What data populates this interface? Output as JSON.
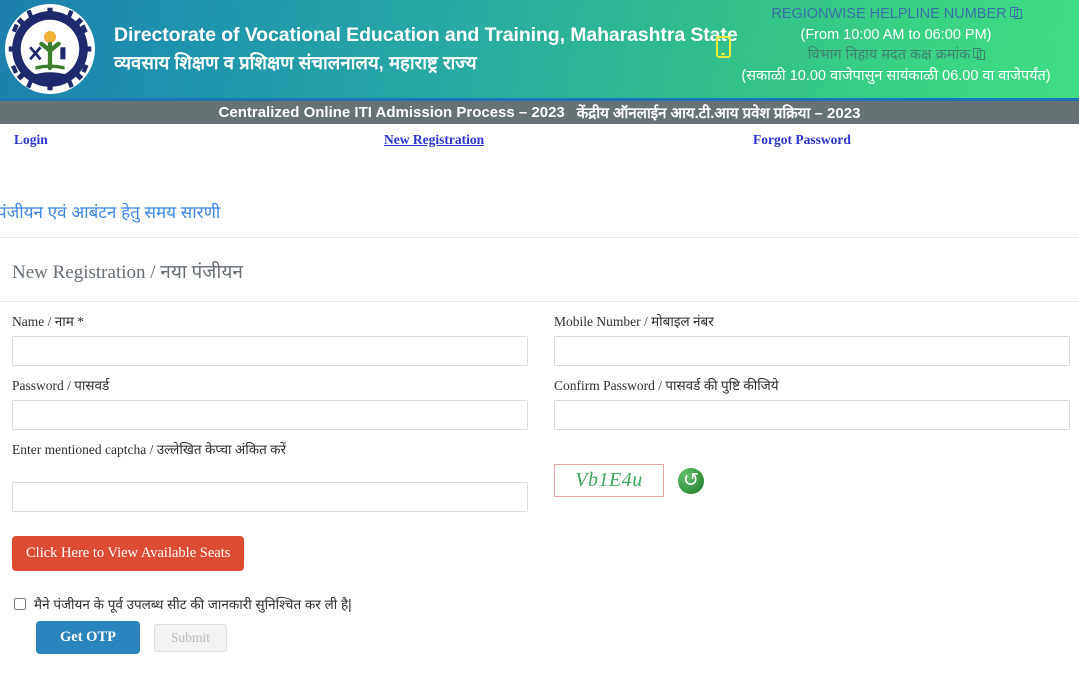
{
  "header": {
    "logo_alt": "dvet-logo",
    "title_en": "Directorate of Vocational Education and Training, Maharashtra State",
    "title_mr": "व्यवसाय शिक्षण व प्रशिक्षण संचालनालय, महाराष्ट्र राज्य",
    "phone_icon": "mobile-phone-icon",
    "helpline": {
      "line1": "REGIONWISE HELPLINE NUMBER",
      "line2": "(From 10:00 AM to 06:00 PM)",
      "line3": "विभाग निहाय मदत कक्ष क्रमांक",
      "line4": "(सकाळी 10.00 वाजेपासुन सायंकाळी 06.00 वा वाजेपर्यंत)",
      "copy_icon": "copy-icon"
    }
  },
  "titlebar": {
    "text_en": "Centralized Online ITI Admission Process – 2023",
    "text_mr": "केंद्रीय ऑनलाईन आय.टी.आय प्रवेश प्रक्रिया – 2023"
  },
  "nav": {
    "login": "Login",
    "new_registration": "New Registration",
    "forgot_password": "Forgot Password"
  },
  "timetable": {
    "heading": "पंजीयन एवं आबंटन हेतु समय सारणी"
  },
  "form": {
    "section_title": "New Registration / नया पंजीयन",
    "name_label": "Name / नाम *",
    "name_value": "",
    "mobile_label": "Mobile Number / मोबाइल नंबर",
    "mobile_value": "",
    "password_label": "Password / पासवर्ड",
    "password_value": "",
    "confirm_password_label": "Confirm Password / पासवर्ड की पुष्टि कीजिये",
    "confirm_password_value": "",
    "captcha_label": "Enter mentioned captcha / उल्लेखित केप्चा अंकित करें",
    "captcha_value": "",
    "captcha_text": "Vb1E4u",
    "refresh_icon": "refresh-captcha-icon",
    "seats_button": "Click Here to View Available Seats",
    "consent_checkbox_label": "मैने पंजीयन के पूर्व उपलब्ध सीट की जानकारी सुनिश्चित कर ली है|",
    "get_otp_button": "Get OTP",
    "submit_button": "Submit"
  },
  "colors": {
    "header_gradient_start": "#1d7fae",
    "header_gradient_end": "#41dd86",
    "titlebar_bg": "#667274",
    "titlebar_top_strip": "#1b76b8",
    "link_blue": "#2b34d0",
    "heading_blue": "#3b86e8",
    "seats_button_bg": "#dd4b32",
    "otp_button_bg": "#2a85be",
    "captcha_text": "#3fa85f",
    "captcha_border": "#e8a6a6",
    "phone_icon": "#ecec3c"
  }
}
